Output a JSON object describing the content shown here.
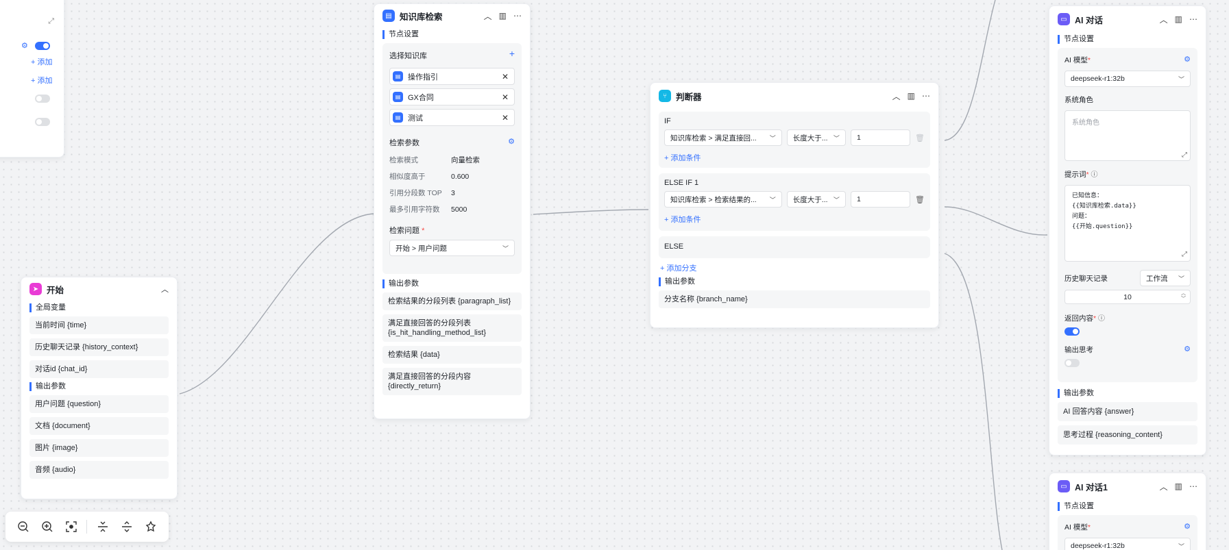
{
  "colors": {
    "accent": "#3370ff",
    "start_icon": "#e93bd5",
    "kb_icon": "#3370ff",
    "judge_icon": "#14b8e6",
    "ai_icon": "#6b5cf6"
  },
  "left_panel": {
    "add_label_1": "+ 添加",
    "add_label_2": "+ 添加"
  },
  "start_node": {
    "title": "开始",
    "global_vars_title": "全局变量",
    "global_vars": [
      "当前时间 {time}",
      "历史聊天记录 {history_context}",
      "对话id {chat_id}"
    ],
    "output_title": "输出参数",
    "outputs": [
      "用户问题 {question}",
      "文档 {document}",
      "图片 {image}",
      "音频 {audio}"
    ]
  },
  "kb_node": {
    "title": "知识库检索",
    "settings_title": "节点设置",
    "select_kb_label": "选择知识库",
    "kb_items": [
      "操作指引",
      "GX合同",
      "测试"
    ],
    "search_params_label": "检索参数",
    "params": [
      {
        "k": "检索模式",
        "v": "向量检索"
      },
      {
        "k": "相似度高于",
        "v": "0.600"
      },
      {
        "k": "引用分段数 TOP",
        "v": "3"
      },
      {
        "k": "最多引用字符数",
        "v": "5000"
      }
    ],
    "question_label": "检索问题",
    "question_value": "开始 > 用户问题",
    "output_title": "输出参数",
    "outputs": [
      "检索结果的分段列表 {paragraph_list}",
      "满足直接回答的分段列表 {is_hit_handling_method_list}",
      "检索结果 {data}",
      "满足直接回答的分段内容 {directly_return}"
    ]
  },
  "judge_node": {
    "title": "判断器",
    "if_label": "IF",
    "if_field": "知识库检索 > 满足直接回...",
    "if_op": "长度大于...",
    "if_value": "1",
    "add_condition": "+ 添加条件",
    "elseif_label": "ELSE IF 1",
    "elseif_field": "知识库检索 > 检索结果的...",
    "elseif_op": "长度大于...",
    "elseif_value": "1",
    "add_condition_2": "+ 添加条件",
    "else_label": "ELSE",
    "add_branch": "+ 添加分支",
    "output_title": "输出参数",
    "output": "分支名称 {branch_name}"
  },
  "ai_node": {
    "title": "AI 对话",
    "settings_title": "节点设置",
    "model_label": "AI 模型",
    "model_value": "deepseek-r1:32b",
    "role_label": "系统角色",
    "role_placeholder": "系统角色",
    "prompt_label": "提示词",
    "prompt_lines": [
      "已知信息：",
      "{{知识库检索.data}}",
      "问题：",
      "{{开始.question}}"
    ],
    "history_label": "历史聊天记录",
    "history_mode": "工作流",
    "history_count": "10",
    "return_label": "返回内容",
    "think_label": "输出思考",
    "output_title": "输出参数",
    "outputs": [
      "AI 回答内容 {answer}",
      "思考过程 {reasoning_content}"
    ]
  },
  "ai_node_1": {
    "title": "AI 对话1",
    "settings_title": "节点设置",
    "model_label": "AI 模型",
    "model_value": "deepseek-r1:32b"
  }
}
